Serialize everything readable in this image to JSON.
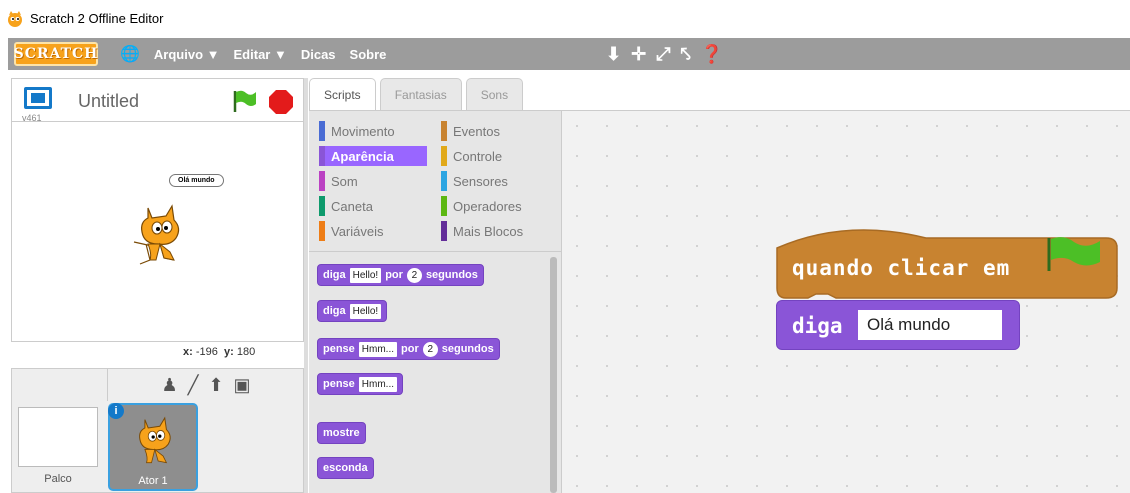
{
  "window": {
    "title": "Scratch 2 Offline Editor"
  },
  "menubar": {
    "logo": "SCRATCH",
    "items": [
      "Arquivo ▼",
      "Editar ▼",
      "Dicas",
      "Sobre"
    ],
    "tools": [
      "duplicate-stamp-icon",
      "cut-scissors-icon",
      "grow-icon",
      "shrink-icon",
      "help-icon"
    ]
  },
  "stage": {
    "title": "Untitled",
    "version": "v461",
    "speech": "Olá mundo",
    "coords": {
      "x_label": "x:",
      "x": "-196",
      "y_label": "y:",
      "y": "180"
    }
  },
  "sprites": {
    "stage_label": "Palco",
    "items": [
      {
        "name": "Ator 1"
      }
    ]
  },
  "tabs": [
    "Scripts",
    "Fantasias",
    "Sons"
  ],
  "categories": {
    "left": [
      {
        "label": "Movimento",
        "color": "#4a6cd4"
      },
      {
        "label": "Aparência",
        "color": "#8a55d7",
        "selected": true
      },
      {
        "label": "Som",
        "color": "#bb42c3"
      },
      {
        "label": "Caneta",
        "color": "#0e9a6c"
      },
      {
        "label": "Variáveis",
        "color": "#ee7d16"
      }
    ],
    "right": [
      {
        "label": "Eventos",
        "color": "#c88330"
      },
      {
        "label": "Controle",
        "color": "#e1a91a"
      },
      {
        "label": "Sensores",
        "color": "#2ca5e2"
      },
      {
        "label": "Operadores",
        "color": "#5cb712"
      },
      {
        "label": "Mais Blocos",
        "color": "#632d99"
      }
    ]
  },
  "palette_blocks": {
    "b1": {
      "cmd": "diga",
      "field": "Hello!",
      "mid": "por",
      "num": "2",
      "end": "segundos"
    },
    "b2": {
      "cmd": "diga",
      "field": "Hello!"
    },
    "b3": {
      "cmd": "pense",
      "field": "Hmm...",
      "mid": "por",
      "num": "2",
      "end": "segundos"
    },
    "b4": {
      "cmd": "pense",
      "field": "Hmm..."
    },
    "b5": {
      "cmd": "mostre"
    },
    "b6": {
      "cmd": "esconda"
    }
  },
  "script": {
    "hat_label": "quando clicar em",
    "say_label": "diga",
    "say_value": "Olá mundo",
    "colors": {
      "events": "#c88330",
      "looks": "#8a55d7",
      "flag": "#4cbf26"
    }
  }
}
